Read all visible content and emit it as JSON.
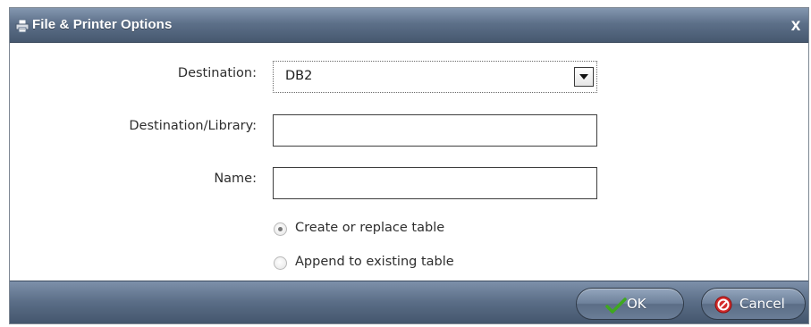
{
  "dialog": {
    "title": "File & Printer Options",
    "close_glyph": "x",
    "title_icon": "printer-icon"
  },
  "form": {
    "destination_label": "Destination:",
    "destination_value": "DB2",
    "library_label": "Destination/Library:",
    "library_value": "",
    "name_label": "Name:",
    "name_value": "",
    "radio_options": [
      {
        "label": "Create or replace table",
        "checked": true
      },
      {
        "label": "Append to existing table",
        "checked": false
      }
    ]
  },
  "buttons": {
    "ok_label": "OK",
    "ok_icon": "checkmark-icon",
    "cancel_label": "Cancel",
    "cancel_icon": "stop-icon"
  },
  "colors": {
    "titlebar": "#5d7089",
    "footer": "#5a6d86",
    "ok_check": "#3fa81f",
    "cancel_icon": "#d42a2a"
  }
}
